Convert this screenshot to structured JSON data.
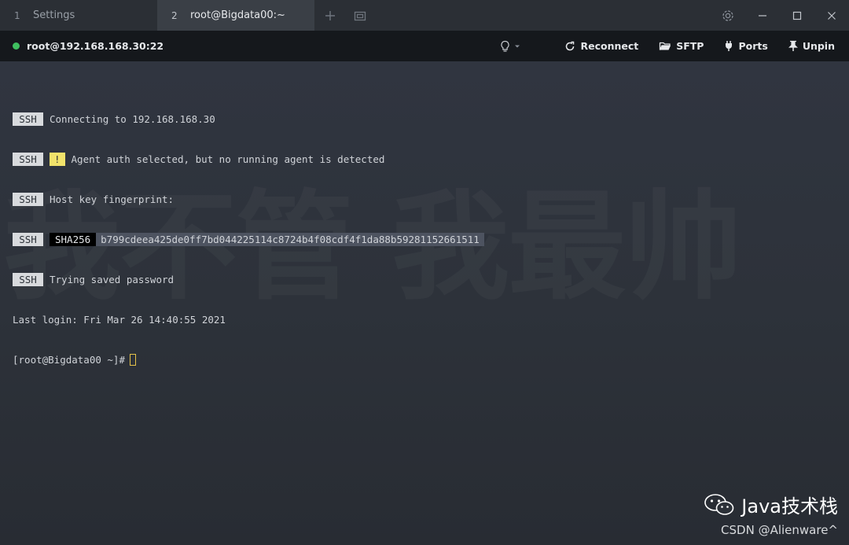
{
  "tabs": [
    {
      "num": "1",
      "label": "Settings"
    },
    {
      "num": "2",
      "label": "root@Bigdata00:~"
    }
  ],
  "toolbar": {
    "host": "root@192.168.168.30:22",
    "reconnect": "Reconnect",
    "sftp": "SFTP",
    "ports": "Ports",
    "unpin": "Unpin"
  },
  "terminal": {
    "ssh_tag": "SSH",
    "line1": "Connecting to 192.168.168.30",
    "warn_tag": "!",
    "line2": "Agent auth selected, but no running agent is detected",
    "line3": "Host key fingerprint:",
    "sha_tag": "SHA256",
    "fingerprint": "b799cdeea425de0ff7bd044225114c8724b4f08cdf4f1da88b59281152661511",
    "line5": "Trying saved password",
    "last_login": "Last login: Fri Mar 26 14:40:55 2021",
    "prompt": "[root@Bigdata00 ~]#"
  },
  "background_text": "我不管 我最帅",
  "watermark": {
    "title": "Java技术栈",
    "sub": "CSDN @Alienware^"
  },
  "colors": {
    "status": "#3fbf5f",
    "warning": "#f2e36b",
    "cursor": "#e5c24a"
  }
}
